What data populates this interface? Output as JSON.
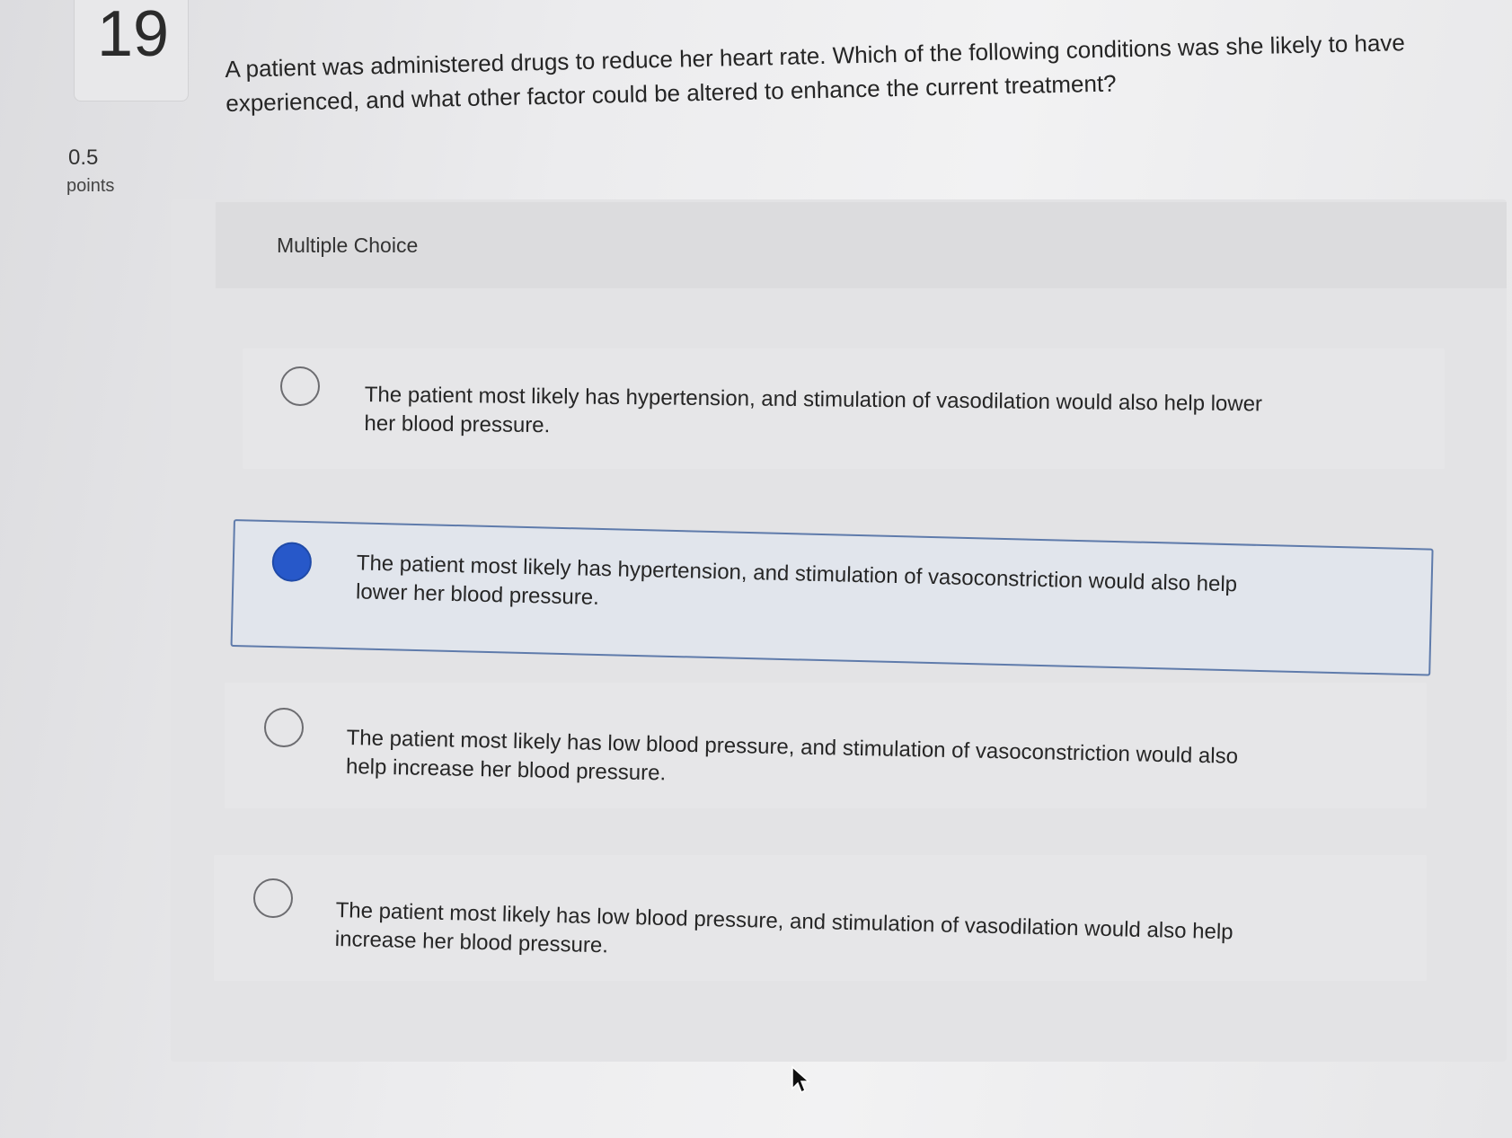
{
  "question": {
    "number": "19",
    "points_value": "0.5",
    "points_label": "points",
    "text": "A patient was administered drugs to reduce her heart rate. Which of the following conditions was she likely to have experienced, and what other factor could be altered to enhance the current treatment?"
  },
  "answer_section": {
    "type_label": "Multiple Choice",
    "options": [
      {
        "label": "The patient most likely has hypertension, and stimulation of vasodilation would also help lower her blood pressure.",
        "selected": false
      },
      {
        "label": "The patient most likely has hypertension, and stimulation of vasoconstriction would also help lower her blood pressure.",
        "selected": true
      },
      {
        "label": "The patient most likely has low blood pressure, and stimulation of vasoconstriction would also help increase her blood pressure.",
        "selected": false
      },
      {
        "label": "The patient most likely has low blood pressure, and stimulation of vasodilation would also help increase her blood pressure.",
        "selected": false
      }
    ]
  },
  "colors": {
    "selected_radio": "#2758c9",
    "selected_border": "#5f7bab"
  },
  "icons": {
    "cursor": "mouse-pointer-icon"
  }
}
